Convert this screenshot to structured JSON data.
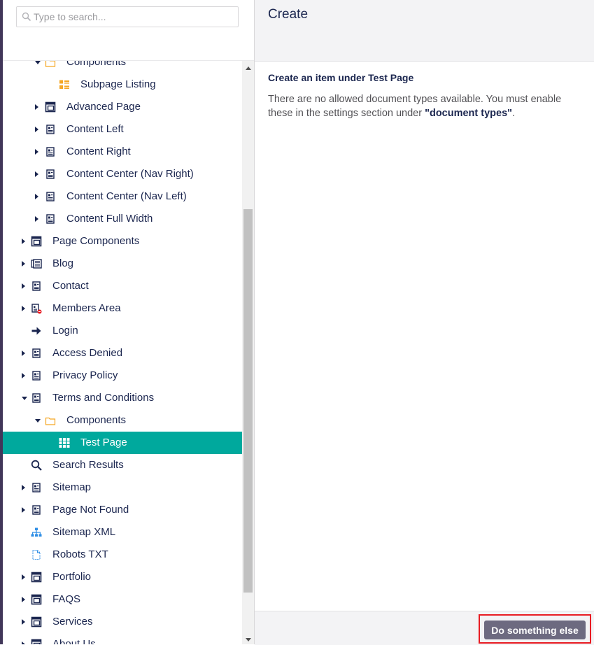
{
  "search": {
    "placeholder": "Type to search..."
  },
  "tree": {
    "items": [
      {
        "label": "Components",
        "level": 1,
        "caret": "expanded",
        "icon": "folder-icon"
      },
      {
        "label": "Subpage Listing",
        "level": 2,
        "caret": "none",
        "icon": "list-icon"
      },
      {
        "label": "Advanced Page",
        "level": 1,
        "caret": "collapsed",
        "icon": "layout-icon"
      },
      {
        "label": "Content Left",
        "level": 1,
        "caret": "collapsed",
        "icon": "document-icon"
      },
      {
        "label": "Content Right",
        "level": 1,
        "caret": "collapsed",
        "icon": "document-icon"
      },
      {
        "label": "Content Center (Nav Right)",
        "level": 1,
        "caret": "collapsed",
        "icon": "document-icon"
      },
      {
        "label": "Content Center (Nav Left)",
        "level": 1,
        "caret": "collapsed",
        "icon": "document-icon"
      },
      {
        "label": "Content Full Width",
        "level": 1,
        "caret": "collapsed",
        "icon": "document-icon"
      },
      {
        "label": "Page Components",
        "level": 0,
        "caret": "collapsed",
        "icon": "layout-icon"
      },
      {
        "label": "Blog",
        "level": 0,
        "caret": "collapsed",
        "icon": "newspaper-icon"
      },
      {
        "label": "Contact",
        "level": 0,
        "caret": "collapsed",
        "icon": "document-icon"
      },
      {
        "label": "Members Area",
        "level": 0,
        "caret": "collapsed",
        "icon": "protected-document-icon"
      },
      {
        "label": "Login",
        "level": 0,
        "caret": "none",
        "icon": "arrow-right-icon"
      },
      {
        "label": "Access Denied",
        "level": 0,
        "caret": "collapsed",
        "icon": "document-icon"
      },
      {
        "label": "Privacy Policy",
        "level": 0,
        "caret": "collapsed",
        "icon": "document-icon"
      },
      {
        "label": "Terms and Conditions",
        "level": 0,
        "caret": "expanded",
        "icon": "document-icon"
      },
      {
        "label": "Components",
        "level": 1,
        "caret": "expanded",
        "icon": "folder-icon"
      },
      {
        "label": "Test Page",
        "level": 2,
        "caret": "none",
        "icon": "grid-icon",
        "selected": true
      },
      {
        "label": "Search Results",
        "level": 0,
        "caret": "none",
        "icon": "search-icon"
      },
      {
        "label": "Sitemap",
        "level": 0,
        "caret": "collapsed",
        "icon": "document-icon"
      },
      {
        "label": "Page Not Found",
        "level": 0,
        "caret": "collapsed",
        "icon": "document-icon"
      },
      {
        "label": "Sitemap XML",
        "level": 0,
        "caret": "none",
        "icon": "sitemap-icon"
      },
      {
        "label": "Robots TXT",
        "level": 0,
        "caret": "none",
        "icon": "file-icon"
      },
      {
        "label": "Portfolio",
        "level": 0,
        "caret": "collapsed",
        "icon": "layout-icon"
      },
      {
        "label": "FAQS",
        "level": 0,
        "caret": "collapsed",
        "icon": "layout-icon"
      },
      {
        "label": "Services",
        "level": 0,
        "caret": "collapsed",
        "icon": "layout-icon"
      },
      {
        "label": "About Us",
        "level": 0,
        "caret": "collapsed",
        "icon": "layout-icon"
      }
    ]
  },
  "panel": {
    "title": "Create",
    "heading": "Create an item under Test Page",
    "message_prefix": "There are no allowed document types available. You must enable these in the settings section under ",
    "message_strong": "\"document types\"",
    "message_suffix": "."
  },
  "footer": {
    "action_label": "Do something else"
  },
  "colors": {
    "selected_bg": "#00a99d",
    "text": "#1b264f",
    "accent_orange": "#f5a623",
    "accent_blue": "#2e8ee5",
    "button_bg": "#6d6a80",
    "highlight": "#e81c23",
    "rail": "#413659"
  }
}
